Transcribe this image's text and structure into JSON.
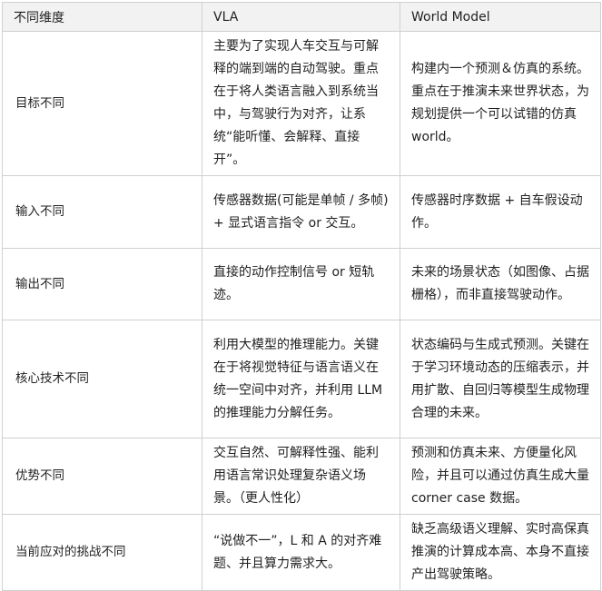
{
  "table": {
    "headers": [
      "不同维度",
      "VLA",
      "World Model"
    ],
    "rows": [
      {
        "dimension": "目标不同",
        "vla": "主要为了实现人车交互与可解释的端到端的自动驾驶。重点在于将人类语言融入到系统当中，与驾驶行为对齐，让系统“能听懂、会解释、直接开”。",
        "world_model": "构建内一个预测＆仿真的系统。重点在于推演未来世界状态，为规划提供一个可以试错的仿真 world。"
      },
      {
        "dimension": "输入不同",
        "vla": "传感器数据(可能是单帧 / 多帧) + 显式语言指令 or 交互。",
        "world_model": "传感器时序数据 + 自车假设动作。"
      },
      {
        "dimension": "输出不同",
        "vla": "直接的动作控制信号 or 短轨迹。",
        "world_model": "未来的场景状态（如图像、占据栅格），而非直接驾驶动作。"
      },
      {
        "dimension": "核心技术不同",
        "vla": "利用大模型的推理能力。关键在于将视觉特征与语言语义在统一空间中对齐，并利用 LLM 的推理能力分解任务。",
        "world_model": "状态编码与生成式预测。关键在于学习环境动态的压缩表示，并用扩散、自回归等模型生成物理合理的未来。"
      },
      {
        "dimension": "优势不同",
        "vla": "交互自然、可解释性强、能利用语言常识处理复杂语义场景。（更人性化）",
        "world_model": "预测和仿真未来、方便量化风险，并且可以通过仿真生成大量 corner case 数据。"
      },
      {
        "dimension": "当前应对的挑战不同",
        "vla": "“说做不一”，L 和 A 的对齐难题、并且算力需求大。",
        "world_model": "缺乏高级语义理解、实时高保真推演的计算成本高、本身不直接产出驾驶策略。"
      }
    ]
  }
}
